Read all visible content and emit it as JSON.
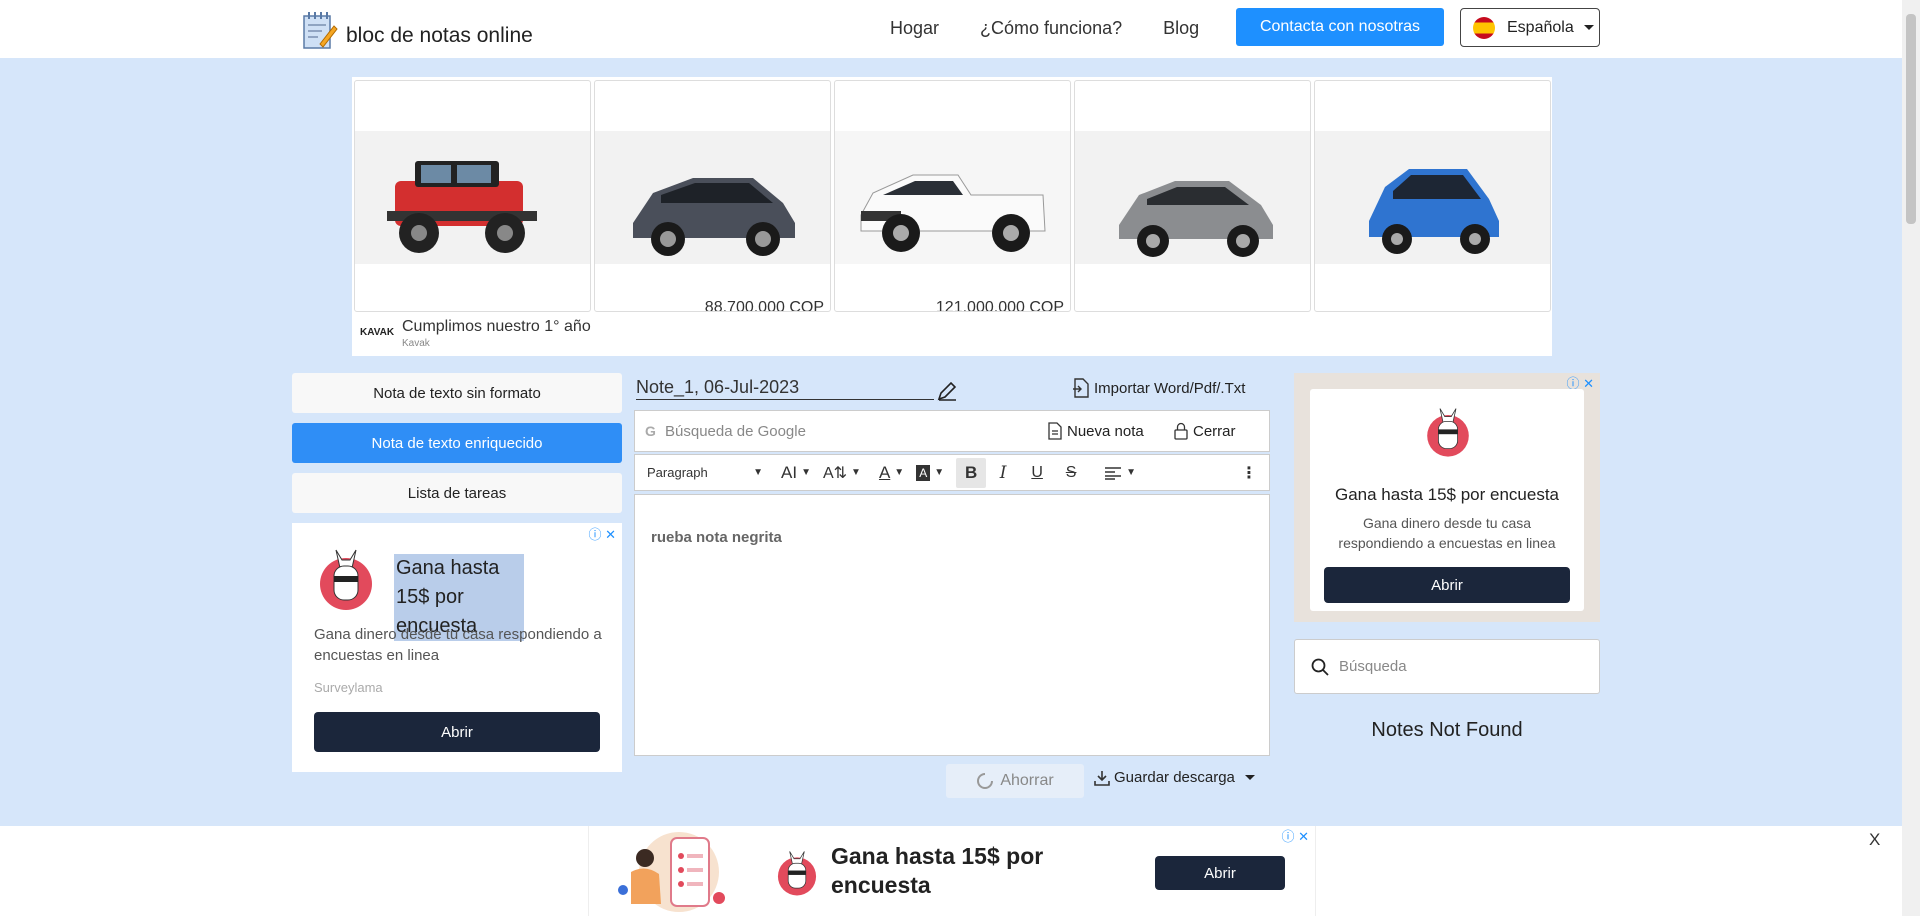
{
  "header": {
    "brand": "bloc de notas online",
    "nav": [
      "Hogar",
      "¿Cómo funciona?",
      "Blog"
    ],
    "contact_button": "Contacta con nosotras",
    "language": "Española"
  },
  "top_ad": {
    "prices": [
      "",
      "88.700.000 COP",
      "121.000.000 COP",
      "",
      ""
    ],
    "advertiser_logo": "KAVAK",
    "title": "Cumplimos nuestro 1° año",
    "advertiser": "Kavak",
    "corner": "ⓘ ✕"
  },
  "note_types": [
    {
      "label": "Nota de texto sin formato",
      "active": false
    },
    {
      "label": "Nota de texto enriquecido",
      "active": true
    },
    {
      "label": "Lista de tareas",
      "active": false
    }
  ],
  "left_ad": {
    "title": "Gana hasta 15$ por encuesta",
    "description": "Gana dinero desde tu casa respondiendo a encuestas en linea",
    "advertiser": "Surveylama",
    "button": "Abrir",
    "corner": "ⓘ ✕"
  },
  "editor": {
    "note_title": "Note_1, 06-Jul-2023",
    "import_label": "Importar Word/Pdf/.Txt",
    "google_search_placeholder": "Búsqueda de Google",
    "new_note": "Nueva nota",
    "close": "Cerrar",
    "block_format": "Paragraph",
    "content": "rueba nota negrita",
    "save": "Ahorrar",
    "save_download": "Guardar descarga"
  },
  "right_ad": {
    "title": "Gana hasta 15$ por encuesta",
    "description": "Gana dinero desde tu casa respondiendo a encuestas en linea",
    "button": "Abrir",
    "corner": "ⓘ ✕"
  },
  "sidebar": {
    "search_placeholder": "Búsqueda",
    "empty_message": "Notes Not Found"
  },
  "bottom_ad": {
    "title": "Gana hasta 15$ por encuesta",
    "button": "Abrir",
    "corner": "ⓘ ✕",
    "close": "X"
  },
  "colors": {
    "accent": "#1e90ff",
    "background": "#d6e6fa",
    "ad_button": "#1b263b"
  }
}
